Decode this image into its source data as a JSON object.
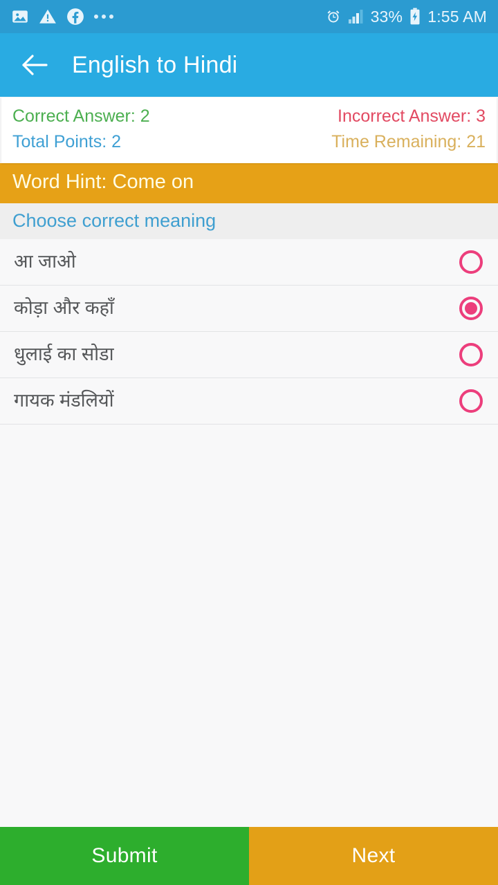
{
  "status_bar": {
    "left_icons": [
      {
        "name": "photo-icon",
        "label": "image"
      },
      {
        "name": "warning-icon",
        "label": "warning"
      },
      {
        "name": "facebook-icon",
        "label": "facebook"
      },
      {
        "name": "more-notifications-icon",
        "label": "more"
      }
    ],
    "alarm_icon": "alarm-clock-icon",
    "signal_icon": "signal-bars-icon",
    "battery_percent": "33%",
    "battery_icon": "battery-charging-icon",
    "clock": "1:55 AM"
  },
  "app_bar": {
    "back_icon": "back-arrow-icon",
    "title": "English to Hindi"
  },
  "scoreboard": {
    "correct_answer": "Correct Answer: 2",
    "incorrect_answer": "Incorrect Answer: 3",
    "total_points": "Total Points: 2",
    "time_remaining": "Time Remaining: 21",
    "colors": {
      "correct": "#4caf50",
      "incorrect": "#e24a62",
      "points": "#3fa0d4",
      "time": "#d9b05c"
    }
  },
  "hint": {
    "text": "Word Hint: Come on",
    "background": "#e6a117"
  },
  "prompt": {
    "text": "Choose correct meaning",
    "color": "#3f9fd0"
  },
  "options": [
    {
      "label": "आ जाओ",
      "selected": false
    },
    {
      "label": "कोड़ा और कहाँ",
      "selected": true
    },
    {
      "label": "धुलाई का सोडा",
      "selected": false
    },
    {
      "label": "गायक मंडलियों",
      "selected": false
    }
  ],
  "option_radio_color": "#ec3e7c",
  "bottom_bar": {
    "submit_label": "Submit",
    "submit_color": "#2dae2d",
    "next_label": "Next",
    "next_color": "#e3a017"
  }
}
